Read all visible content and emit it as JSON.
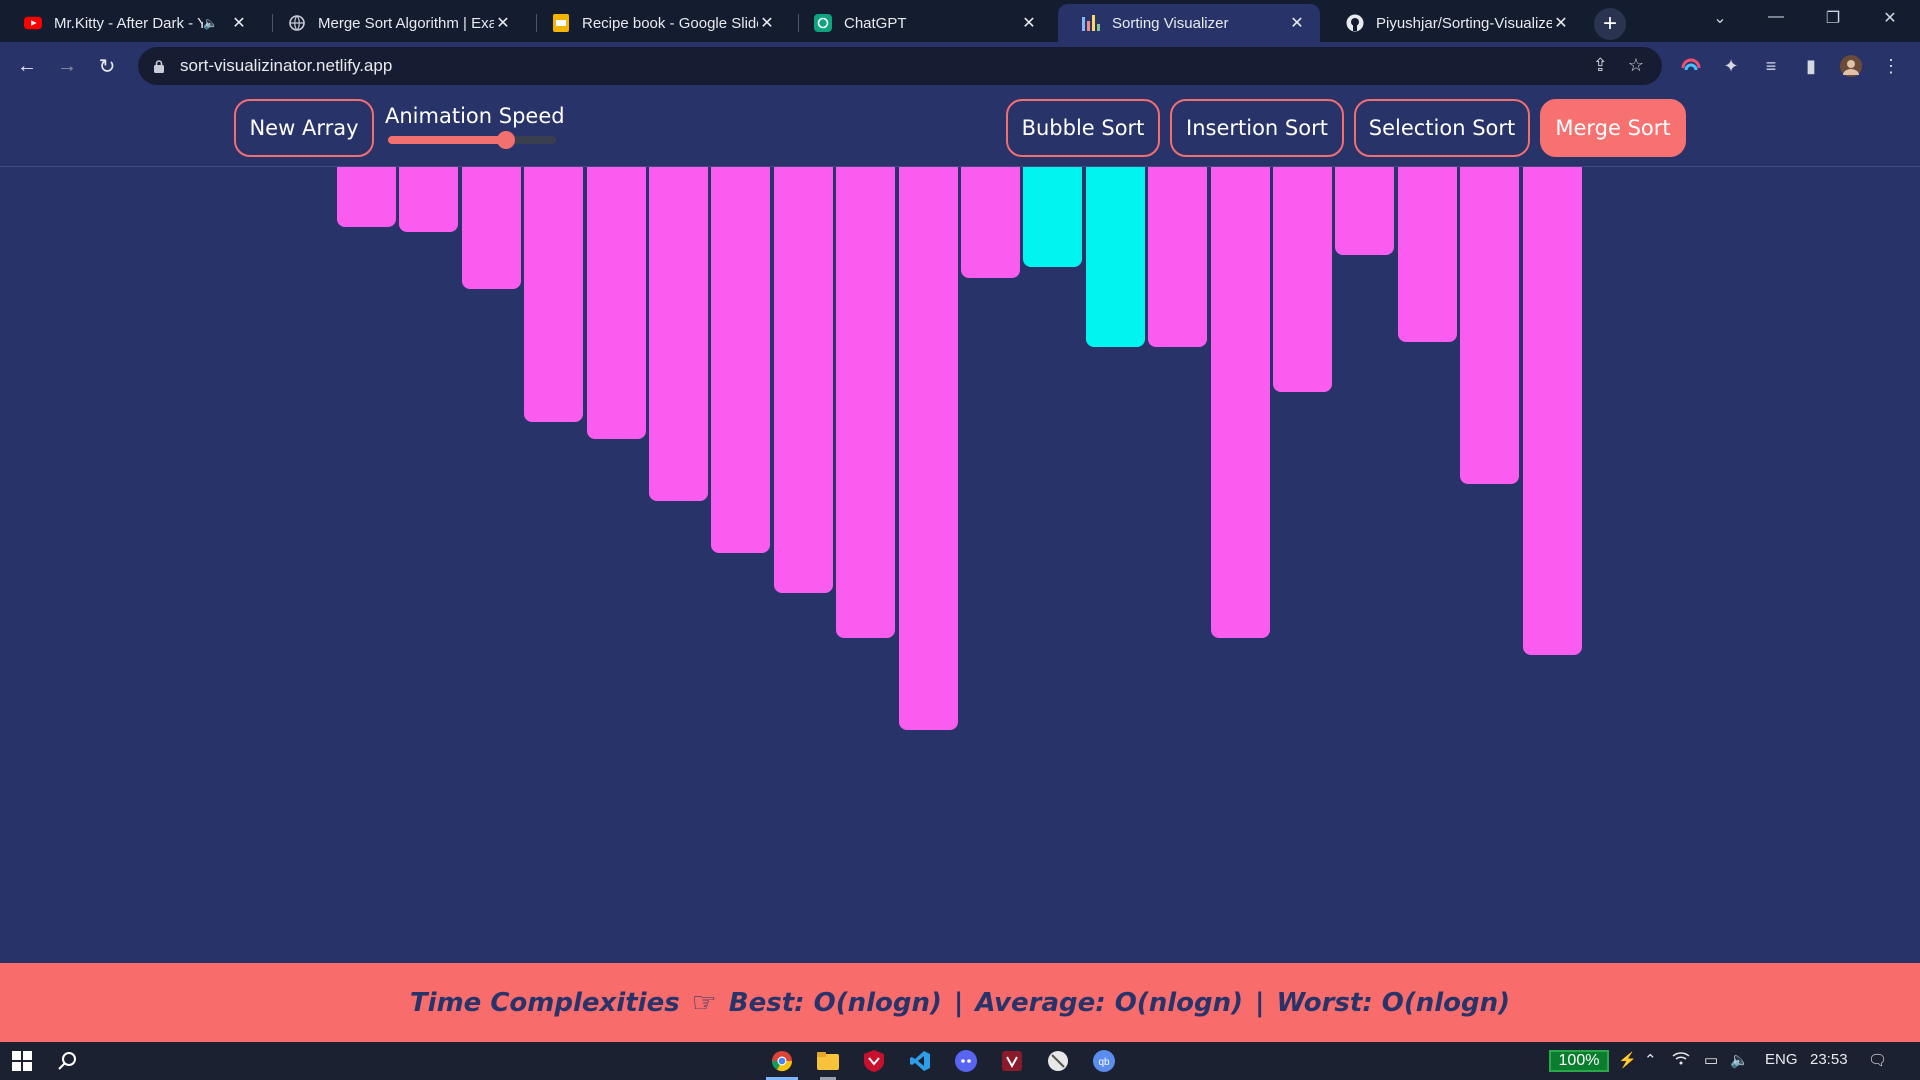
{
  "browser": {
    "tabs": [
      {
        "title": "Mr.Kitty - After Dark - YouTube",
        "favicon": "youtube-icon",
        "muted": true
      },
      {
        "title": "Merge Sort Algorithm | Example",
        "favicon": "globe-icon"
      },
      {
        "title": "Recipe book - Google Slides",
        "favicon": "google-slides-icon"
      },
      {
        "title": "ChatGPT",
        "favicon": "chatgpt-icon"
      },
      {
        "title": "Sorting Visualizer",
        "favicon": "bar-chart-icon",
        "active": true
      },
      {
        "title": "Piyushjar/Sorting-Visualizer",
        "favicon": "github-icon"
      }
    ],
    "url": "sort-visualizinator.netlify.app"
  },
  "header": {
    "new_array": "New Array",
    "speed_label": "Animation Speed",
    "speed_value": 0.7,
    "algorithms": [
      {
        "label": "Bubble Sort"
      },
      {
        "label": "Insertion Sort"
      },
      {
        "label": "Selection Sort"
      },
      {
        "label": "Merge Sort",
        "active": true
      }
    ]
  },
  "visualizer": {
    "bar_color": "#fb5cf0",
    "compare_color": "#00f5f0",
    "bars": [
      {
        "value": 60,
        "state": "default"
      },
      {
        "value": 65,
        "state": "default"
      },
      {
        "value": 122,
        "state": "default"
      },
      {
        "value": 255,
        "state": "default"
      },
      {
        "value": 272,
        "state": "default"
      },
      {
        "value": 334,
        "state": "default"
      },
      {
        "value": 386,
        "state": "default"
      },
      {
        "value": 426,
        "state": "default"
      },
      {
        "value": 471,
        "state": "default"
      },
      {
        "value": 563,
        "state": "default"
      },
      {
        "value": 111,
        "state": "default"
      },
      {
        "value": 100,
        "state": "compare"
      },
      {
        "value": 180,
        "state": "compare"
      },
      {
        "value": 180,
        "state": "default"
      },
      {
        "value": 471,
        "state": "default"
      },
      {
        "value": 225,
        "state": "default"
      },
      {
        "value": 88,
        "state": "default"
      },
      {
        "value": 175,
        "state": "default"
      },
      {
        "value": 317,
        "state": "default"
      },
      {
        "value": 488,
        "state": "default"
      }
    ]
  },
  "footer": {
    "label": "Time Complexities",
    "best": "Best: O(nlogn)",
    "average": "Average: O(nlogn)",
    "worst": "Worst: O(nlogn)",
    "separator": "|"
  },
  "taskbar": {
    "battery": "100%",
    "language": "ENG",
    "time": "23:53"
  }
}
